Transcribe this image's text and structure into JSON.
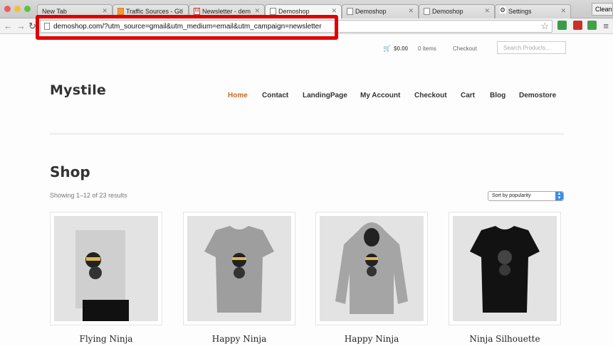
{
  "browser": {
    "tabs": [
      {
        "title": "New Tab"
      },
      {
        "title": "Traffic Sources - Go"
      },
      {
        "title": "Newsletter - dem"
      },
      {
        "title": "Demoshop"
      },
      {
        "title": "Demoshop"
      },
      {
        "title": "Demoshop"
      },
      {
        "title": "Settings"
      }
    ],
    "clean_label": "Clean",
    "url": "demoshop.com/?utm_source=gmail&utm_medium=email&utm_campaign=newsletter",
    "highlight_color": "#e00000"
  },
  "shop": {
    "cart_total": "$0.00",
    "cart_items": "0 items",
    "checkout_link": "Checkout",
    "search_placeholder": "Search Products...",
    "logo": "Mystile",
    "nav": [
      "Home",
      "Contact",
      "LandingPage",
      "My Account",
      "Checkout",
      "Cart",
      "Blog",
      "Demostore"
    ],
    "active_nav": "Home",
    "accent_color": "#c56a28",
    "page_title": "Shop",
    "results_text": "Showing 1–12 of 23 results",
    "sort_value": "Sort by popularity",
    "products": [
      {
        "name": "Flying Ninja",
        "image": "poster-ninja"
      },
      {
        "name": "Happy Ninja",
        "image": "tshirt-grey"
      },
      {
        "name": "Happy Ninja",
        "image": "hoodie-grey"
      },
      {
        "name": "Ninja Silhouette",
        "image": "tshirt-black"
      }
    ]
  }
}
